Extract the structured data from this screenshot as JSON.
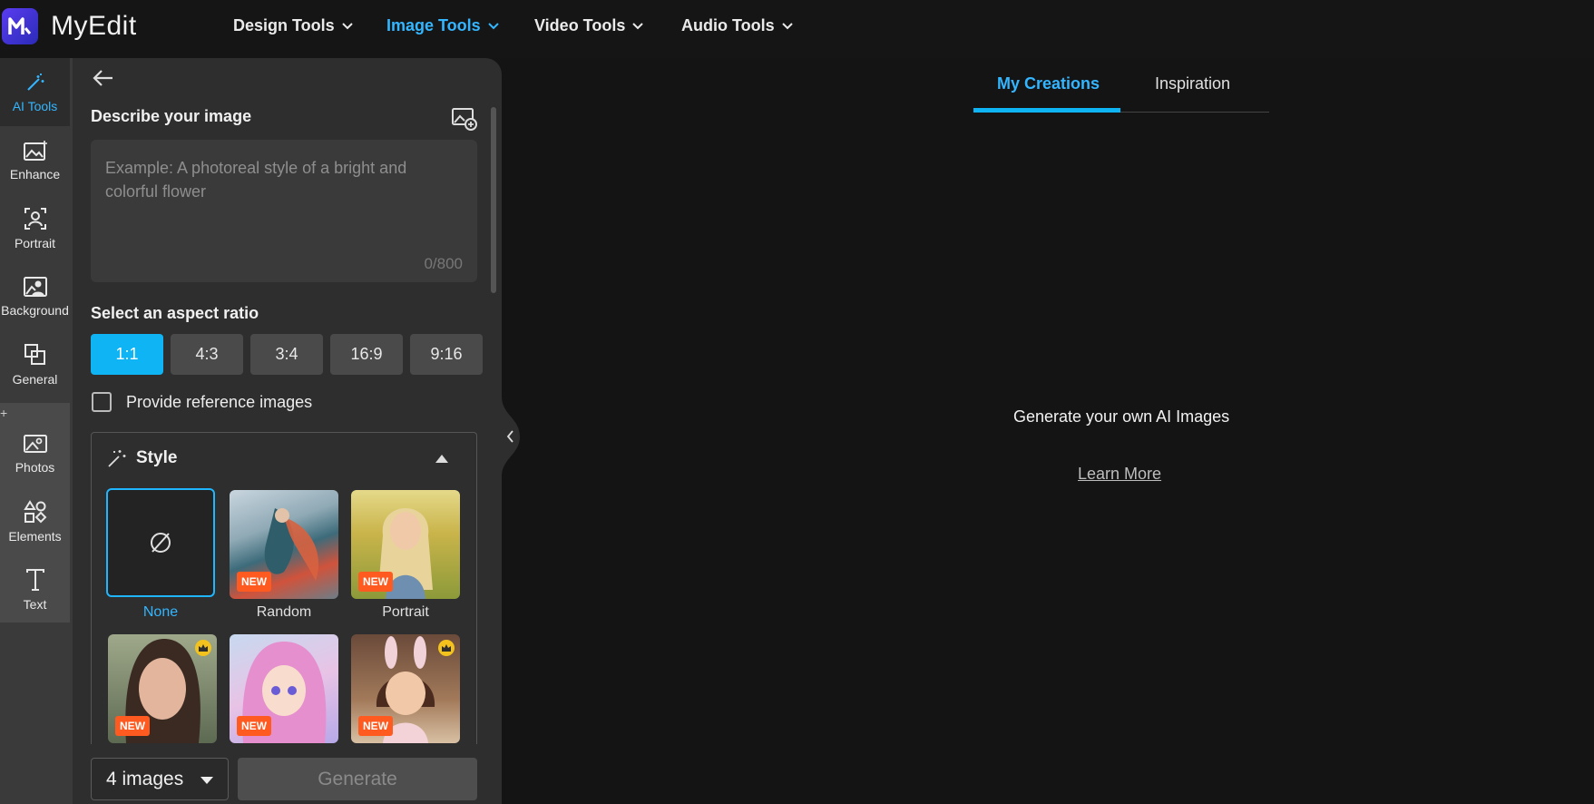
{
  "header": {
    "app_name": "MyEdit",
    "nav": [
      {
        "label": "Design Tools"
      },
      {
        "label": "Image Tools"
      },
      {
        "label": "Video Tools"
      },
      {
        "label": "Audio Tools"
      }
    ],
    "accent_color": "#33b6ff"
  },
  "rail": {
    "items": [
      {
        "label": "AI Tools",
        "icon": "magic-wand-icon"
      },
      {
        "label": "Enhance",
        "icon": "image-sparkle-icon"
      },
      {
        "label": "Portrait",
        "icon": "portrait-icon"
      },
      {
        "label": "Background",
        "icon": "background-icon"
      },
      {
        "label": "General",
        "icon": "crop-icon"
      },
      {
        "label": "Photos",
        "icon": "photo-icon"
      },
      {
        "label": "Elements",
        "icon": "shapes-icon"
      },
      {
        "label": "Text",
        "icon": "text-icon"
      }
    ]
  },
  "panel": {
    "describe_title": "Describe your image",
    "prompt_placeholder": "Example: A photoreal style of a bright and colorful flower",
    "prompt_counter": "0/800",
    "aspect_title": "Select an aspect ratio",
    "aspect_ratios": [
      "1:1",
      "4:3",
      "3:4",
      "16:9",
      "9:16"
    ],
    "selected_ratio": "1:1",
    "reference_label": "Provide reference images",
    "style_title": "Style",
    "styles": [
      {
        "label": "None"
      },
      {
        "label": "Random",
        "badge": "NEW"
      },
      {
        "label": "Portrait",
        "badge": "NEW"
      },
      {
        "badge": "NEW"
      },
      {
        "badge": "NEW"
      },
      {
        "badge": "NEW"
      }
    ],
    "image_count": "4 images",
    "generate_label": "Generate"
  },
  "main": {
    "tabs": [
      "My Creations",
      "Inspiration"
    ],
    "empty_title": "Generate your own AI Images",
    "learn_more": "Learn More"
  }
}
